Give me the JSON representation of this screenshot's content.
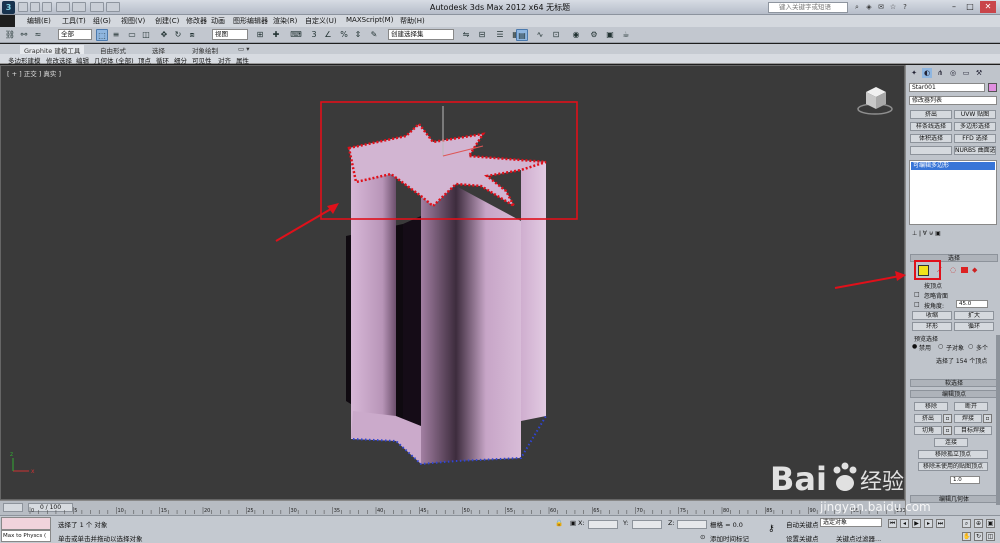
{
  "titlebar": {
    "logo_text": "3",
    "title": "Autodesk 3ds Max  2012 x64      无标题",
    "search_placeholder": "键入关键字或短语"
  },
  "menu": [
    "编辑(E)",
    "工具(T)",
    "组(G)",
    "视图(V)",
    "创建(C)",
    "修改器",
    "动画",
    "图形编辑器",
    "渲染(R)",
    "自定义(U)",
    "MAXScript(M)",
    "帮助(H)"
  ],
  "toolbar": {
    "selection_filter": "全部",
    "ref_coord": "视图",
    "named_selection": "创建选择集"
  },
  "ribbon": {
    "tabs": [
      "Graphite 建模工具",
      "自由形式",
      "选择",
      "对象绘制"
    ],
    "sub_items": [
      "多边形建模",
      "修改选择",
      "编辑",
      "几何体 (全部)",
      "顶点",
      "循环",
      "细分",
      "可见性",
      "对齐",
      "属性"
    ]
  },
  "viewport": {
    "label": "[ + ] 正交 ] 真实 ]",
    "highlight_color": "#e0101a",
    "object_color": "#c9a6c9",
    "axis_labels": {
      "x": "x",
      "y": "y",
      "z": "z"
    }
  },
  "command_panel": {
    "object_name": "Star001",
    "object_color": "#e08fe0",
    "modifier_list": "修改器列表",
    "buttons": [
      "挤出",
      "UVW 贴图",
      "样条线选择",
      "多边形选择",
      "体积选择",
      "FFD 选择",
      "",
      "NURBS 曲面选择"
    ],
    "stack_item": "可编辑多边形",
    "selection_header": "选择",
    "by_vertex": "按顶点",
    "ignore_backfacing": "忽略背面",
    "by_angle": "按角度:",
    "angle_value": "45.0",
    "shrink": "收缩",
    "grow": "扩大",
    "ring": "环形",
    "loop": "循环",
    "preview_selection": "预览选择",
    "preview_disabled": "禁用",
    "preview_subobject": "子对象",
    "preview_multi": "多个",
    "selected_count": "选择了 154 个顶点",
    "soft_selection": "软选择",
    "edit_vertices": "编辑顶点",
    "remove": "移除",
    "break": "断开",
    "extrude": "挤出",
    "weld": "焊接",
    "chamfer": "切角",
    "target_weld": "目标焊接",
    "connect": "连接",
    "remove_isolated": "移除孤立顶点",
    "remove_unused_map": "移除未使用的贴图顶点",
    "weight_value": "1.0",
    "edit_geometry": "编辑几何体",
    "highlight_color": "#e0101a",
    "vertex_button_color": "#f2e21a"
  },
  "timeline": {
    "slider": "0 / 100",
    "ticks": [
      "0",
      "5",
      "10",
      "15",
      "20",
      "25",
      "30",
      "35",
      "40",
      "45",
      "50",
      "55",
      "60",
      "65",
      "70",
      "75",
      "80",
      "85",
      "90",
      "95",
      "100"
    ]
  },
  "status": {
    "maxscript_label": "Max to Physcs (",
    "line1": "选择了 1 个 对象",
    "line2": "单击或单击并拖动以选择对象",
    "x_label": "X:",
    "y_label": "Y:",
    "z_label": "Z:",
    "grid": "栅格 = 0.0",
    "add_time_tag": "添加时间标记",
    "auto_key": "自动关键点",
    "selected_obj": "选定对象",
    "set_key": "设置关键点",
    "key_filters": "关键点过滤器..."
  },
  "watermark": {
    "brand": "Bai",
    "brand2": "经验",
    "url": "jingyan.baidu.com"
  }
}
